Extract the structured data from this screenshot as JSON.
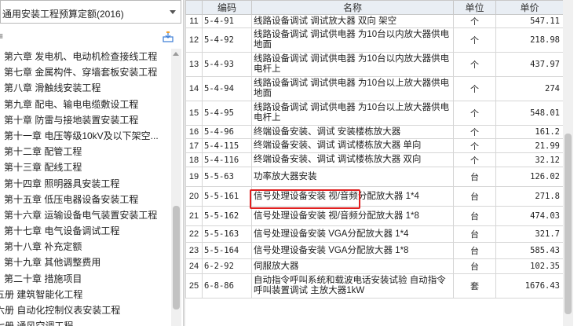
{
  "quota_selector": {
    "value": "通用安装工程预算定额(2016)"
  },
  "search_partial": "≡",
  "tree": [
    "第六章 发电机、电动机检查接线工程",
    "第七章 金属构件、穿墙套板安装工程",
    "第八章 滑触线安装工程",
    "第九章 配电、输电电缆敷设工程",
    "第十章 防雷与接地装置安装工程",
    "第十一章 电压等级10kV及以下架空...",
    "第十二章 配管工程",
    "第十三章 配线工程",
    "第十四章 照明器具安装工程",
    "第十五章 低压电器设备安装工程",
    "第十六章 运输设备电气装置安装工程",
    "第十七章 电气设备调试工程",
    "第十八章 补充定额",
    "第十九章 其他调整费用",
    "第二十章 措施项目",
    "五册 建筑智能化工程",
    "六册 自动化控制仪表安装工程",
    "七册 通风空调工程"
  ],
  "table": {
    "headers": {
      "code": "编码",
      "name": "名称",
      "unit": "单位",
      "price": "单价"
    },
    "rows": [
      {
        "seq": "11",
        "code": "5-4-91",
        "name": "线路设备调试 调试放大器 双向 架空",
        "unit": "个",
        "price": "547.11"
      },
      {
        "seq": "12",
        "code": "5-4-92",
        "name": "线路设备调试 调试供电器 为10台以内放大器供电 地面",
        "unit": "个",
        "price": "218.98"
      },
      {
        "seq": "13",
        "code": "5-4-93",
        "name": "线路设备调试 调试供电器 为10台以内放大器供电 电杆上",
        "unit": "个",
        "price": "437.97"
      },
      {
        "seq": "14",
        "code": "5-4-94",
        "name": "线路设备调试 调试供电器 为10台以上放大器供电 地面",
        "unit": "个",
        "price": "274"
      },
      {
        "seq": "15",
        "code": "5-4-95",
        "name": "线路设备调试 调试供电器 为10台以上放大器供电 电杆上",
        "unit": "个",
        "price": "548.01"
      },
      {
        "seq": "16",
        "code": "5-4-96",
        "name": "终端设备安装、调试 安装楼栋放大器",
        "unit": "个",
        "price": "161.2"
      },
      {
        "seq": "17",
        "code": "5-4-115",
        "name": "终端设备安装、调试 调试楼栋放大器 单向",
        "unit": "个",
        "price": "21.99"
      },
      {
        "seq": "18",
        "code": "5-4-116",
        "name": "终端设备安装、调试 调试楼栋放大器 双向",
        "unit": "个",
        "price": "32.12"
      },
      {
        "seq": "19",
        "code": "5-5-63",
        "name": "功率放大器安装",
        "unit": "台",
        "price": "126.02"
      },
      {
        "seq": "20",
        "code": "5-5-161",
        "name": "信号处理设备安装 视/音频分配放大器 1*4",
        "unit": "台",
        "price": "271.8"
      },
      {
        "seq": "21",
        "code": "5-5-162",
        "name": "信号处理设备安装 视/音频分配放大器 1*8",
        "unit": "台",
        "price": "474.03"
      },
      {
        "seq": "22",
        "code": "5-5-163",
        "name": "信号处理设备安装 VGA分配放大器 1*4",
        "unit": "台",
        "price": "321.7"
      },
      {
        "seq": "23",
        "code": "5-5-164",
        "name": "信号处理设备安装 VGA分配放大器 1*8",
        "unit": "台",
        "price": "585.43"
      },
      {
        "seq": "24",
        "code": "6-2-92",
        "name": "伺服放大器",
        "unit": "台",
        "price": "102.35"
      },
      {
        "seq": "25",
        "code": "6-8-86",
        "name": "自动指令呼叫系统和载波电话安装试验 自动指令呼叫装置调试 主放大器1kW",
        "unit": "套",
        "price": "1676.43"
      }
    ]
  },
  "highlight_color": "#e02020"
}
